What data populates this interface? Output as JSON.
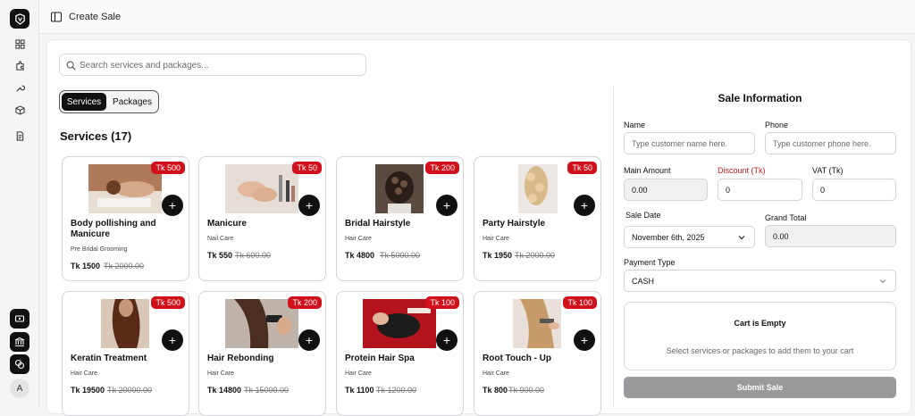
{
  "header": {
    "title": "Create Sale"
  },
  "rail": {
    "avatar": "A"
  },
  "search": {
    "placeholder": "Search services and packages..."
  },
  "tabs": {
    "services": "Services",
    "packages": "Packages"
  },
  "services_heading": "Services (17)",
  "cards": [
    {
      "name": "Body pollishing and Manicure",
      "category": "Pre Bridal Grooming",
      "tag": "Tk 500",
      "price": "Tk 1500",
      "old_price": "Tk 2000.00"
    },
    {
      "name": "Manicure",
      "category": "Nail Care",
      "tag": "Tk 50",
      "price": "Tk 550",
      "old_price": "Tk 600.00"
    },
    {
      "name": "Bridal Hairstyle",
      "category": "Hair Care",
      "tag": "Tk 200",
      "price": "Tk 4800",
      "old_price": "Tk 5000.00"
    },
    {
      "name": "Party Hairstyle",
      "category": "Hair Care",
      "tag": "Tk 50",
      "price": "Tk 1950",
      "old_price": "Tk 2000.00"
    },
    {
      "name": "Keratin Treatment",
      "category": "Hair Care",
      "tag": "Tk 500",
      "price": "Tk 19500",
      "old_price": "Tk 20000.00"
    },
    {
      "name": "Hair Rebonding",
      "category": "Hair Care",
      "tag": "Tk 200",
      "price": "Tk 14800",
      "old_price": "Tk 15000.00"
    },
    {
      "name": "Protein Hair Spa",
      "category": "Hair Care",
      "tag": "Tk 100",
      "price": "Tk 1100",
      "old_price": "Tk 1200.00"
    },
    {
      "name": "Root Touch - Up",
      "category": "Hair Care",
      "tag": "Tk 100",
      "price": "Tk 800",
      "old_price": "Tk 900.00"
    }
  ],
  "add_symbol": "+",
  "sale": {
    "title": "Sale Information",
    "name_label": "Name",
    "name_placeholder": "Type customer name here.",
    "phone_label": "Phone",
    "phone_placeholder": "Type customer phone here.",
    "main_amount_label": "Main Amount",
    "main_amount_value": "0.00",
    "discount_label": "Discount (Tk)",
    "discount_value": "0",
    "vat_label": "VAT (Tk)",
    "vat_value": "0",
    "sale_date_label": "Sale Date",
    "sale_date_value": "November 6th, 2025",
    "grand_total_label": "Grand Total",
    "grand_total_value": "0.00",
    "payment_type_label": "Payment Type",
    "payment_type_value": "CASH",
    "cart_title": "Cart is Empty",
    "cart_subtitle": "Select services or packages to add them to your cart",
    "submit_label": "Submit Sale"
  },
  "colors": {
    "accent": "#d0101b",
    "dark": "#111111",
    "discount_label": "#c51c1c",
    "submit_disabled": "#9a9a9d"
  }
}
